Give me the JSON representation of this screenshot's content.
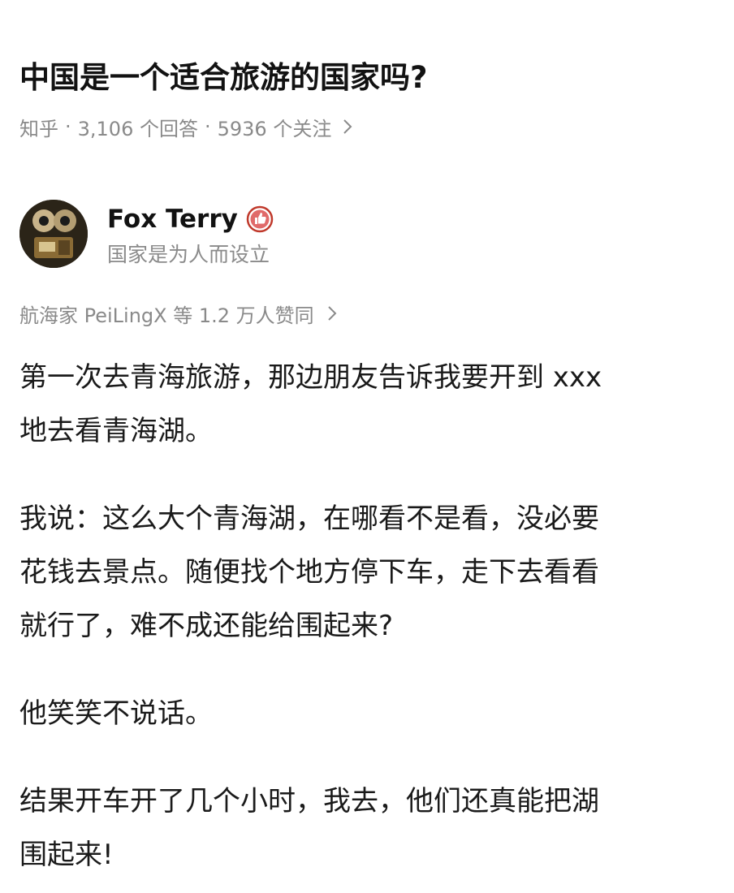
{
  "question": {
    "title": "中国是一个适合旅游的国家吗?",
    "meta": {
      "site": "知乎",
      "answers": "3,106 个回答",
      "followers": "5936 个关注"
    }
  },
  "author": {
    "name": "Fox Terry",
    "bio": "国家是为人而设立",
    "badge_icon": "thumbs-up-badge-icon",
    "badge_color": "#c0392b"
  },
  "voters": {
    "text": "航海家 PeiLingX 等 1.2 万人赞同"
  },
  "answer": {
    "paragraphs": [
      {
        "lines": [
          "第一次去青海旅游，那边朋友告诉我要开到 xxx",
          "地去看青海湖。"
        ]
      },
      {
        "lines": [
          "我说：这么大个青海湖，在哪看不是看，没必要",
          "花钱去景点。随便找个地方停下车，走下去看看",
          "就行了，难不成还能给围起来?"
        ]
      },
      {
        "lines": [
          "他笑笑不说话。"
        ]
      },
      {
        "lines": [
          "结果开车开了几个小时，我去，他们还真能把湖",
          "围起来!"
        ]
      }
    ]
  },
  "colors": {
    "text": "#1a1a1a",
    "meta": "#8a8a8a",
    "background": "#ffffff"
  }
}
